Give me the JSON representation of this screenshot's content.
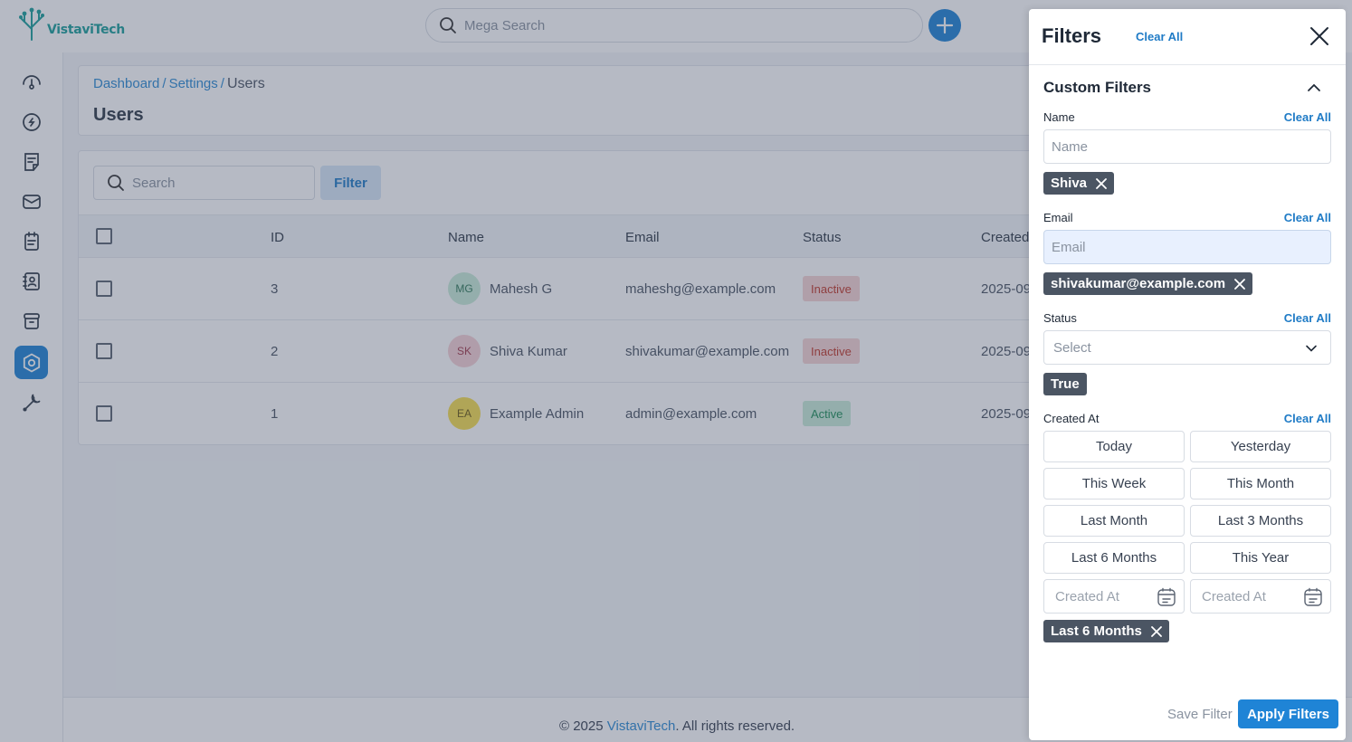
{
  "app": {
    "logo_text": "VistaviTech"
  },
  "topbar": {
    "search_placeholder": "Mega Search"
  },
  "breadcrumb": {
    "items": [
      "Dashboard",
      "Settings"
    ],
    "separator": "/",
    "current": "Users"
  },
  "page": {
    "title": "Users"
  },
  "table": {
    "search_placeholder": "Search",
    "filter_label": "Filter",
    "columns": [
      "ID",
      "Name",
      "Email",
      "Status",
      "Created"
    ],
    "rows": [
      {
        "id": "3",
        "initials": "MG",
        "name": "Mahesh G",
        "email": "maheshg@example.com",
        "status": "Inactive",
        "created": "2025-09",
        "avatar_bg": "#c9ecd9",
        "avatar_fg": "#2f7a58"
      },
      {
        "id": "2",
        "initials": "SK",
        "name": "Shiva Kumar",
        "email": "shivakumar@example.com",
        "status": "Inactive",
        "created": "2025-09",
        "avatar_bg": "#f5d0d5",
        "avatar_fg": "#a23a4c"
      },
      {
        "id": "1",
        "initials": "EA",
        "name": "Example Admin",
        "email": "admin@example.com",
        "status": "Active",
        "created": "2025-09",
        "avatar_bg": "#f6de4f",
        "avatar_fg": "#6b5a12"
      }
    ]
  },
  "footer": {
    "prefix": "© 2025 ",
    "brand": "VistaviTech",
    "suffix": ". All rights reserved."
  },
  "filters": {
    "title": "Filters",
    "clear_all": "Clear All",
    "section_title": "Custom Filters",
    "name": {
      "label": "Name",
      "clear": "Clear All",
      "placeholder": "Name",
      "chip": "Shiva"
    },
    "email": {
      "label": "Email",
      "clear": "Clear All",
      "placeholder": "Email",
      "chip": "shivakumar@example.com"
    },
    "status": {
      "label": "Status",
      "clear": "Clear All",
      "placeholder": "Select",
      "chip": "True"
    },
    "created": {
      "label": "Created At",
      "clear": "Clear All",
      "quick": [
        "Today",
        "Yesterday",
        "This Week",
        "This Month",
        "Last Month",
        "Last 3 Months",
        "Last 6 Months",
        "This Year"
      ],
      "from_placeholder": "Created At",
      "to_placeholder": "Created At",
      "chip": "Last 6 Months"
    },
    "save_label": "Save Filter",
    "apply_label": "Apply Filters"
  },
  "colors": {
    "primary": "#1f84d6",
    "overlay": "#3e4a63",
    "chip": "#4b5563",
    "logo": "#1a9e9a"
  },
  "icons": {
    "sidebar": [
      "dashboard-icon",
      "integrations-icon",
      "notes-icon",
      "mail-icon",
      "document-icon",
      "contacts-icon",
      "archive-icon",
      "settings-icon",
      "tools-icon"
    ]
  }
}
